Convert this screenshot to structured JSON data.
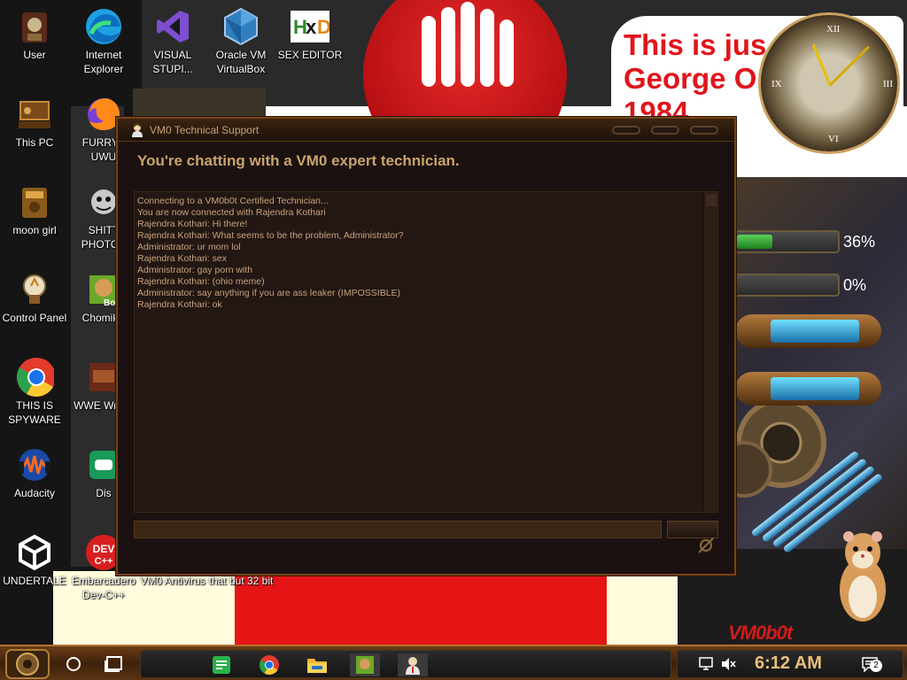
{
  "desktop": {
    "wallpaper_text": "This is just like George Orwell's 1984",
    "wallpaper_text_visible": "This is jus\nGeorge Or\n1984",
    "watermark": "VM0b0t",
    "gauges": [
      {
        "label": "36%",
        "value": 36
      },
      {
        "label": "0%",
        "value": 0
      }
    ],
    "icons": [
      {
        "label": "User",
        "icon": "user-icon"
      },
      {
        "label": "Internet Explorer",
        "icon": "edge-icon"
      },
      {
        "label": "VISUAL STUPI...",
        "icon": "visual-studio-icon"
      },
      {
        "label": "Oracle VM VirtualBox",
        "icon": "virtualbox-icon"
      },
      {
        "label": "SEX EDITOR",
        "icon": "hxd-icon"
      },
      {
        "label": "This PC",
        "icon": "this-pc-icon"
      },
      {
        "label": "FURRYF UWU",
        "icon": "firefox-icon"
      },
      {
        "label": "moon girl",
        "icon": "moon-girl-icon"
      },
      {
        "label": "SHITT PHOTOS",
        "icon": "photos-icon"
      },
      {
        "label": "Control Panel",
        "icon": "control-panel-icon"
      },
      {
        "label": "ChomikB",
        "icon": "chomik-icon"
      },
      {
        "label": "THIS IS SPYWARE",
        "icon": "chrome-icon"
      },
      {
        "label": "WWE Wrestl",
        "icon": "wwe-icon"
      },
      {
        "label": "Audacity",
        "icon": "audacity-icon"
      },
      {
        "label": "Dis",
        "icon": "discord-icon"
      },
      {
        "label": "UNDERTALE",
        "icon": "unity-icon"
      },
      {
        "label": "Embarcadero Dev-C++",
        "icon": "devcpp-icon"
      },
      {
        "label": "VM0 Antivirus",
        "icon": "antivirus-icon"
      },
      {
        "label": "that but 32 bit",
        "icon": "bit32-icon"
      }
    ]
  },
  "window": {
    "title": "VM0 Technical Support",
    "heading": "You're chatting with a VM0 expert technician.",
    "chat_lines": [
      "Connecting to a VM0b0t Certified Technician...",
      "You are now connected with Rajendra Kothari",
      "Rajendra Kothari: Hi there!",
      "Rajendra Kothari: What seems to be the problem, Administrator?",
      "Administrator: ur mom lol",
      "Rajendra Kothari: sex",
      "Administrator: gay porn with",
      "Rajendra Kothari: (ohio meme)",
      "Administrator: say anything if you are ass leaker (IMPOSSIBLE)",
      "Rajendra Kothari: ok"
    ],
    "input_value": "",
    "input_placeholder": ""
  },
  "taskbar": {
    "apps": [
      {
        "name": "sticky-notes-icon"
      },
      {
        "name": "chrome-icon"
      },
      {
        "name": "file-explorer-icon"
      },
      {
        "name": "chomik-box-icon"
      },
      {
        "name": "tech-support-icon"
      }
    ],
    "clock": "6:12 AM",
    "notification_count": "2"
  },
  "colors": {
    "window_bg": "#1b1110",
    "accent_brown": "#7a4314",
    "chat_text": "#c8a27d",
    "heading_text": "#c9a46c",
    "wallpaper_red": "#e0151c"
  }
}
